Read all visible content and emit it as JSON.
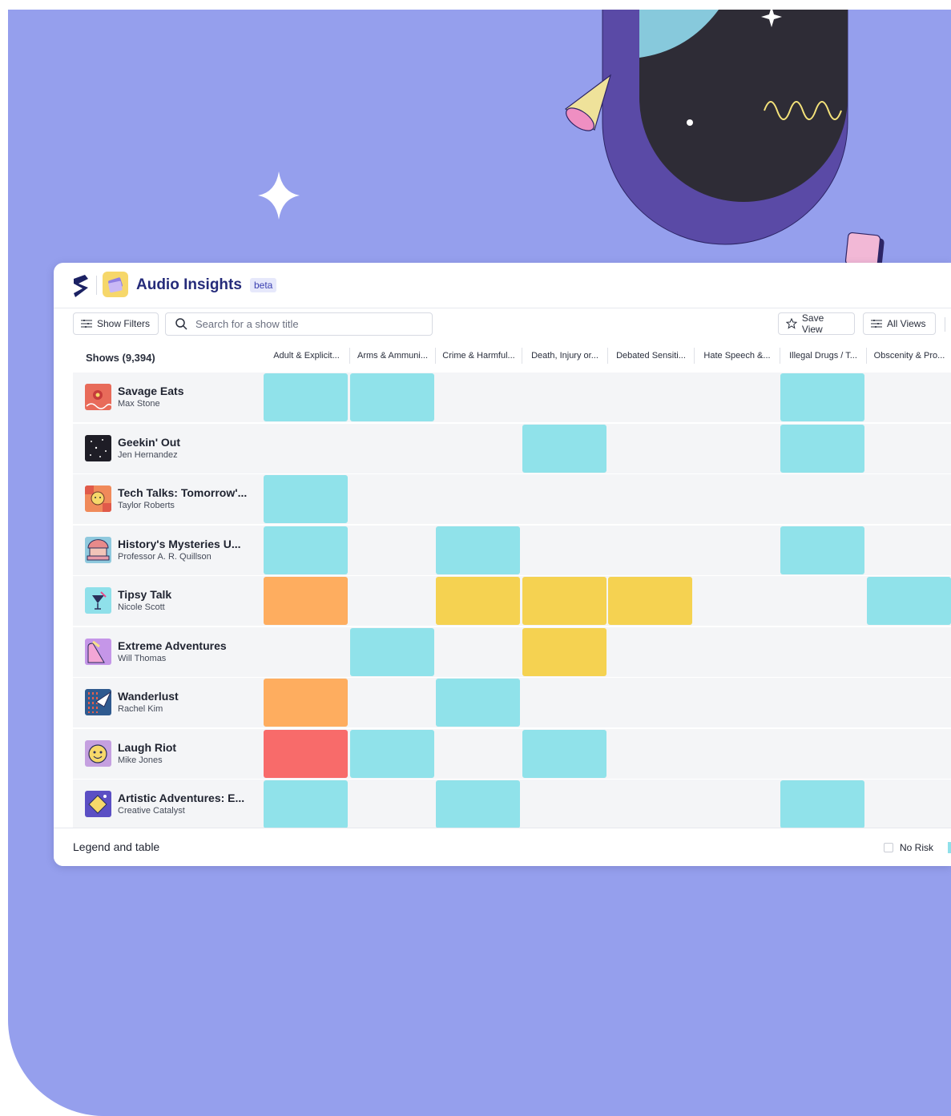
{
  "app": {
    "title": "Audio Insights",
    "badge": "beta"
  },
  "toolbar": {
    "show_filters": "Show Filters",
    "search_placeholder": "Search for a show title",
    "save_view": "Save View",
    "all_views": "All Views"
  },
  "table": {
    "shows_header": "Shows (9,394)",
    "columns": [
      "Adult & Explicit...",
      "Arms & Ammuni...",
      "Crime & Harmful...",
      "Death, Injury or...",
      "Debated Sensiti...",
      "Hate Speech &...",
      "Illegal Drugs / T...",
      "Obscenity & Pro..."
    ],
    "risk_colors": {
      "none": "",
      "low": "#90e2ea",
      "medium": "#f5d251",
      "high": "#fead5f",
      "floor": "#f86b6a"
    },
    "rows": [
      {
        "title": "Savage Eats",
        "host": "Max Stone",
        "thumb_icon": "flower-icon",
        "risks": [
          "low",
          "low",
          "none",
          "none",
          "none",
          "none",
          "low",
          "none"
        ]
      },
      {
        "title": "Geekin' Out",
        "host": "Jen Hernandez",
        "thumb_icon": "stars-icon",
        "risks": [
          "none",
          "none",
          "none",
          "low",
          "none",
          "none",
          "low",
          "none"
        ]
      },
      {
        "title": "Tech Talks: Tomorrow'...",
        "host": "Taylor Roberts",
        "thumb_icon": "face-icon",
        "risks": [
          "low",
          "none",
          "none",
          "none",
          "none",
          "none",
          "none",
          "none"
        ]
      },
      {
        "title": "History's Mysteries U...",
        "host": "Professor A. R. Quillson",
        "thumb_icon": "temple-icon",
        "risks": [
          "low",
          "none",
          "low",
          "none",
          "none",
          "none",
          "low",
          "none"
        ]
      },
      {
        "title": "Tipsy Talk",
        "host": "Nicole Scott",
        "thumb_icon": "cocktail-icon",
        "risks": [
          "high",
          "none",
          "medium",
          "medium",
          "medium",
          "none",
          "none",
          "low"
        ]
      },
      {
        "title": "Extreme Adventures",
        "host": "Will Thomas",
        "thumb_icon": "mountain-icon",
        "risks": [
          "none",
          "low",
          "none",
          "medium",
          "none",
          "none",
          "none",
          "none"
        ]
      },
      {
        "title": "Wanderlust",
        "host": "Rachel Kim",
        "thumb_icon": "paper-plane-icon",
        "risks": [
          "high",
          "none",
          "low",
          "none",
          "none",
          "none",
          "none",
          "none"
        ]
      },
      {
        "title": "Laugh Riot",
        "host": "Mike Jones",
        "thumb_icon": "smiley-icon",
        "risks": [
          "floor",
          "low",
          "none",
          "low",
          "none",
          "none",
          "none",
          "none"
        ]
      },
      {
        "title": "Artistic Adventures: E...",
        "host": "Creative Catalyst",
        "thumb_icon": "palette-icon",
        "risks": [
          "low",
          "none",
          "low",
          "none",
          "none",
          "none",
          "low",
          "none"
        ]
      }
    ]
  },
  "footer": {
    "legend_title": "Legend and table",
    "no_risk_label": "No Risk"
  }
}
